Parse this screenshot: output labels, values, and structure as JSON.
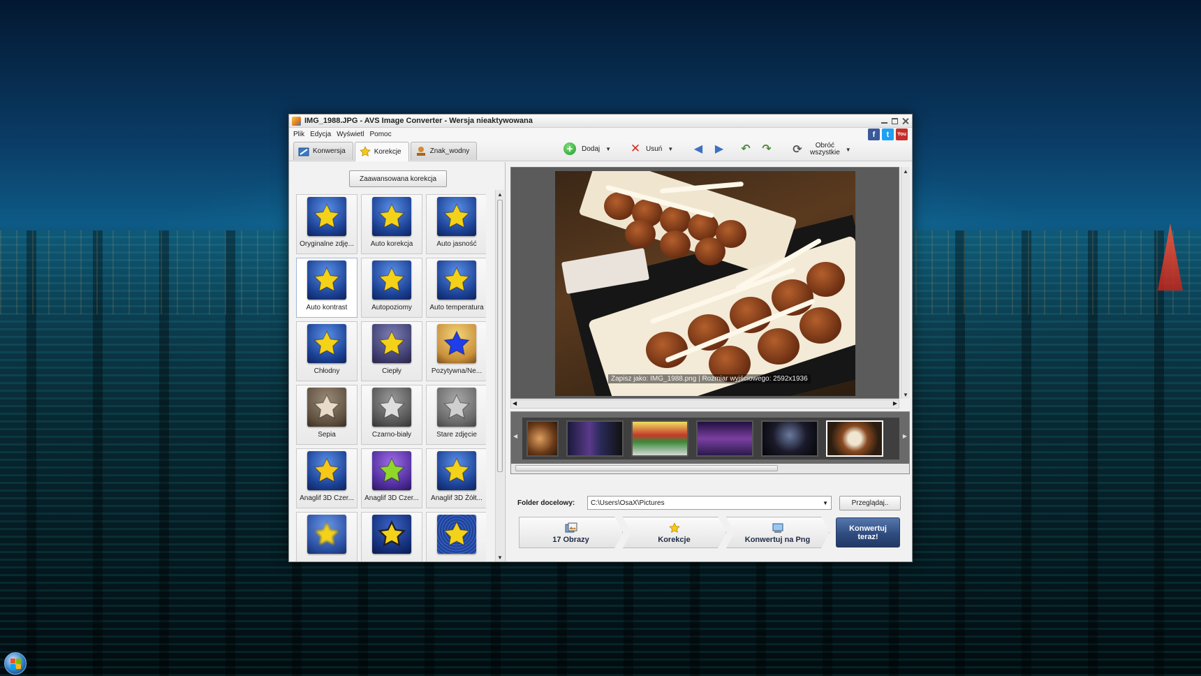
{
  "window": {
    "title": "IMG_1988.JPG - AVS Image Converter - Wersja nieaktywowana"
  },
  "menu": [
    "Plik",
    "Edycja",
    "Wyświetl",
    "Pomoc"
  ],
  "social": {
    "facebook": "f",
    "twitter": "t",
    "youtube": "You"
  },
  "tabs": [
    {
      "label": "Konwersja",
      "icon": "convert-icon",
      "active": false
    },
    {
      "label": "Korekcje",
      "icon": "star-icon",
      "active": true
    },
    {
      "label": "Znak_wodny",
      "icon": "stamp-icon",
      "active": false
    }
  ],
  "toolbar": {
    "add_label": "Dodaj",
    "remove_label": "Usuń",
    "rotate_all_line1": "Obróć",
    "rotate_all_line2": "wszystkie"
  },
  "corrections": {
    "advanced_button": "Zaawansowana korekcja",
    "items": [
      {
        "label": "Oryginalne zdję...",
        "star": "#f5d21a",
        "bg": "blue"
      },
      {
        "label": "Auto korekcja",
        "star": "#f5d21a",
        "bg": "blue"
      },
      {
        "label": "Auto jasność",
        "star": "#f5d21a",
        "bg": "blue"
      },
      {
        "label": "Auto kontrast",
        "star": "#f5d21a",
        "bg": "blue"
      },
      {
        "label": "Autopoziomy",
        "star": "#f5d21a",
        "bg": "blue"
      },
      {
        "label": "Auto temperatura",
        "star": "#f5d21a",
        "bg": "blue"
      },
      {
        "label": "Chłodny",
        "star": "#f5d21a",
        "bg": "blue"
      },
      {
        "label": "Ciepły",
        "star": "#f5d21a",
        "bg": "warm"
      },
      {
        "label": "Pozytywna/Ne...",
        "star": "#1f3de8",
        "bg": "negative"
      },
      {
        "label": "Sepia",
        "star": "#e8dcc8",
        "bg": "sepia"
      },
      {
        "label": "Czarno-biały",
        "star": "#dedede",
        "bg": "gray"
      },
      {
        "label": "Stare zdjęcie",
        "star": "#cfcfcf",
        "bg": "old"
      },
      {
        "label": "Anaglif 3D Czer...",
        "star": "#f5c81a",
        "bg": "blue"
      },
      {
        "label": "Anaglif 3D Czer...",
        "star": "#8fd82a",
        "bg": "purple"
      },
      {
        "label": "Anaglif 3D Żółt...",
        "star": "#f5d21a",
        "bg": "blue"
      },
      {
        "label": "",
        "star": "#f5d21a",
        "bg": "blur"
      },
      {
        "label": "",
        "star": "#f5d21a",
        "bg": "outline"
      },
      {
        "label": "",
        "star": "#f5d21a",
        "bg": "noise"
      }
    ]
  },
  "preview": {
    "caption": "Zapisz jako: IMG_1988.png | Rozmiar wyjściowego: 2592x1936"
  },
  "filmstrip": {
    "thumbs": [
      "food",
      "street-night",
      "market",
      "city-night",
      "dark-stage",
      "takoyaki"
    ],
    "selected_index": 5
  },
  "output": {
    "folder_label": "Folder docelowy:",
    "folder_value": "C:\\Users\\OsaX\\Pictures",
    "browse_label": "Przeglądaj.."
  },
  "steps": [
    {
      "label": "17 Obrazy",
      "icon": "images-icon"
    },
    {
      "label": "Korekcje",
      "icon": "star-icon"
    },
    {
      "label": "Konwertuj na Png",
      "icon": "convert-png-icon"
    }
  ],
  "convert_button": {
    "line1": "Konwertuj",
    "line2": "teraz!"
  },
  "colors": {
    "accent": "#2f4c80",
    "star_yellow": "#f5d21a"
  }
}
